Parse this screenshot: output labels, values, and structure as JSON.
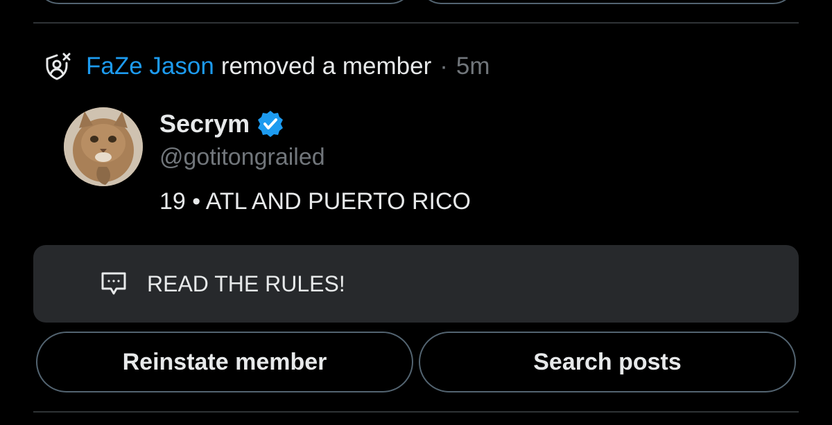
{
  "action": {
    "actor": "FaZe Jason",
    "text": "removed a member",
    "separator": "·",
    "time": "5m",
    "icon": "shield-remove-user-icon"
  },
  "user": {
    "name": "Secrym",
    "handle": "@gotitongrailed",
    "bio": "19 • ATL AND PUERTO RICO",
    "verified": true,
    "avatar": "cat-avatar"
  },
  "reason": {
    "text": "READ THE RULES!",
    "icon": "message-bubble-icon"
  },
  "buttons": {
    "reinstate": "Reinstate member",
    "search": "Search posts"
  },
  "colors": {
    "background": "#000000",
    "accent": "#1d9bf0",
    "muted": "#71767b",
    "text": "#e7e9ea",
    "border": "#536471",
    "card": "#27292c"
  }
}
